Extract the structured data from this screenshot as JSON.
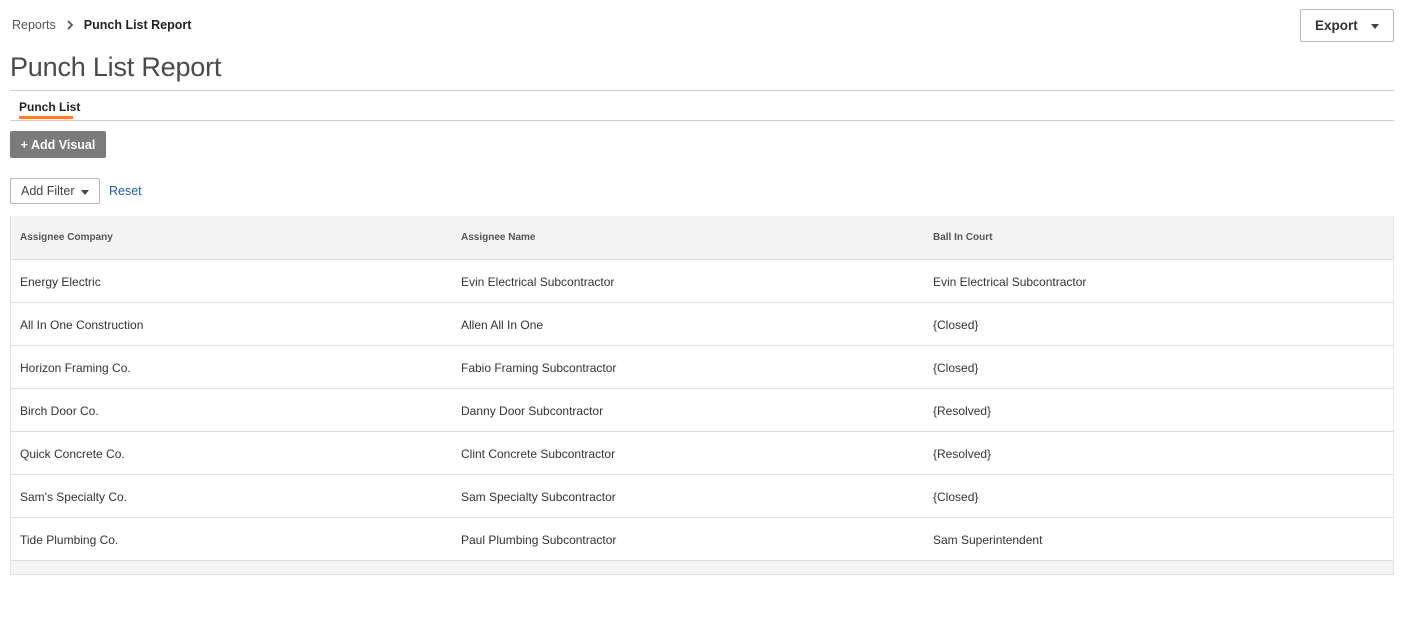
{
  "breadcrumb": {
    "parent": "Reports",
    "current": "Punch List Report"
  },
  "export": {
    "label": "Export"
  },
  "title": "Punch List Report",
  "tabs": [
    {
      "label": "Punch List",
      "active": true
    }
  ],
  "toolbar": {
    "add_visual": "+ Add Visual",
    "add_filter": "Add Filter",
    "reset": "Reset"
  },
  "table": {
    "columns": [
      "Assignee Company",
      "Assignee Name",
      "Ball In Court"
    ],
    "rows": [
      [
        "Energy Electric",
        "Evin Electrical Subcontractor",
        "Evin Electrical Subcontractor"
      ],
      [
        "All In One Construction",
        "Allen All In One",
        "{Closed}"
      ],
      [
        "Horizon Framing Co.",
        "Fabio Framing Subcontractor",
        "{Closed}"
      ],
      [
        "Birch Door Co.",
        "Danny Door Subcontractor",
        "{Resolved}"
      ],
      [
        "Quick Concrete Co.",
        "Clint Concrete Subcontractor",
        "{Resolved}"
      ],
      [
        "Sam's Specialty Co.",
        "Sam Specialty Subcontractor",
        "{Closed}"
      ],
      [
        "Tide Plumbing Co.",
        "Paul Plumbing Subcontractor",
        "Sam Superintendent"
      ]
    ]
  },
  "colors": {
    "accent": "#f47e42",
    "link": "#1d5fa3",
    "button_gray": "#7b7b7b"
  }
}
